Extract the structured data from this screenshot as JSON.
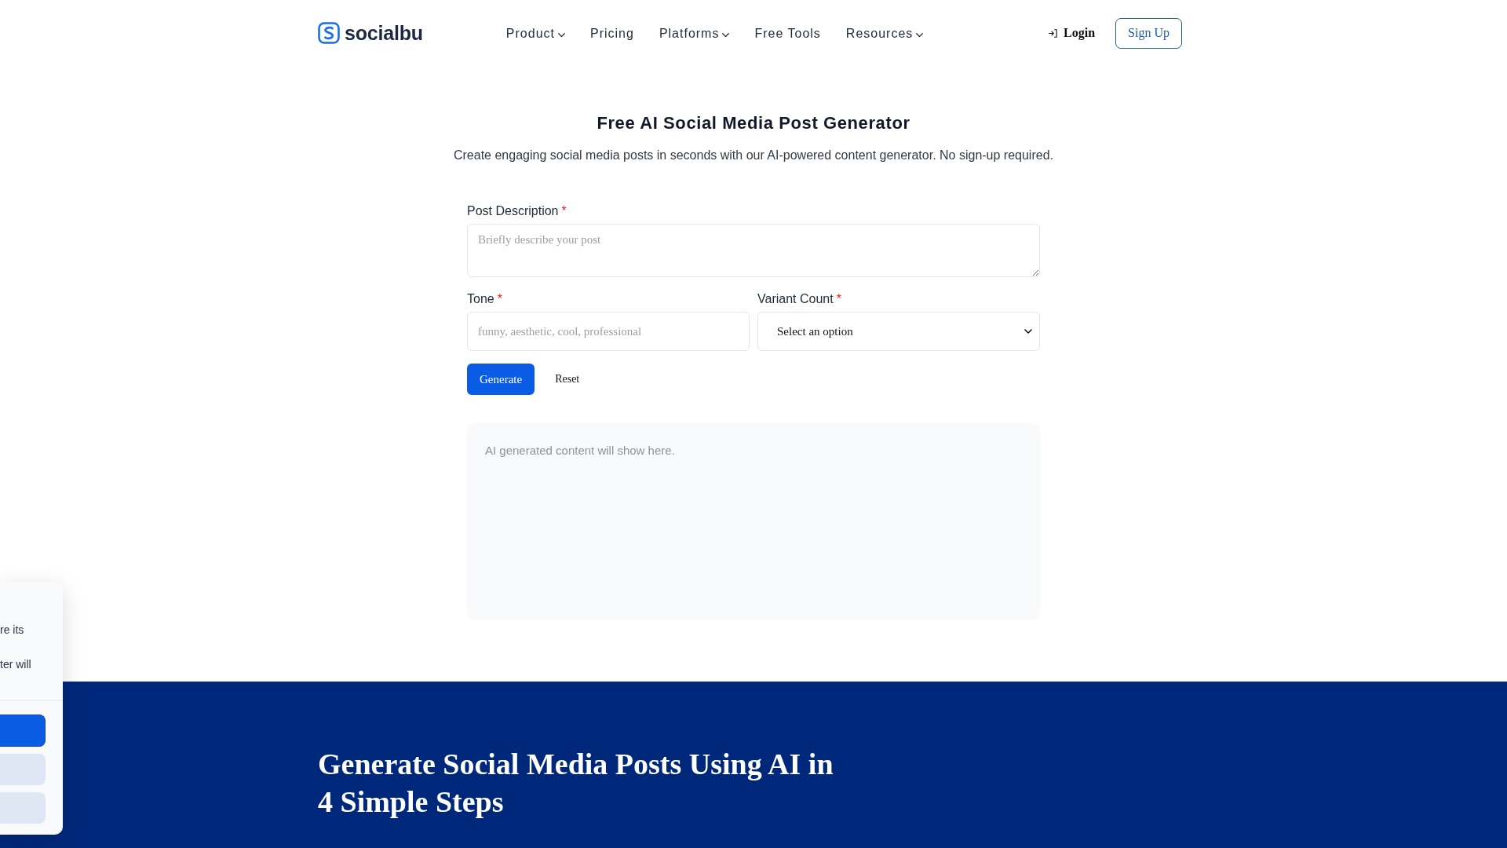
{
  "header": {
    "brand": {
      "name": "socialbu"
    },
    "nav": [
      {
        "label": "Product",
        "dropdown": true
      },
      {
        "label": "Pricing",
        "dropdown": false
      },
      {
        "label": "Platforms",
        "dropdown": true
      },
      {
        "label": "Free Tools",
        "dropdown": false
      },
      {
        "label": "Resources",
        "dropdown": true
      }
    ],
    "login": {
      "label": "Login"
    },
    "signup": {
      "label": "Sign Up"
    }
  },
  "tool": {
    "title": "Free AI Social Media Post Generator",
    "subtitle": "Create engaging social media posts in seconds with our AI-powered content generator. No sign-up required.",
    "fields": [
      {
        "kind": "textarea",
        "label": "Post Description",
        "required_mark": "*",
        "placeholder": "Briefly describe your post"
      },
      {
        "kind": "text",
        "label": "Tone",
        "required_mark": "*",
        "placeholder": "funny, aesthetic, cool, professional"
      },
      {
        "kind": "select",
        "label": "Variant Count",
        "required_mark": "*",
        "value": "Select an option"
      }
    ],
    "buttons": [
      {
        "kind": "primary",
        "label": "Generate"
      },
      {
        "kind": "plain",
        "label": "Reset"
      }
    ],
    "output": {
      "message": "AI generated content will show here."
    }
  },
  "steps_section": {
    "heading": "Generate Social Media Posts Using AI in 4 Simple Steps"
  },
  "side_panel": {
    "lines": [
      "re its",
      "ter will"
    ],
    "buttons": [
      {
        "kind": "primary"
      },
      {
        "kind": "secondary"
      },
      {
        "kind": "secondary"
      }
    ]
  }
}
